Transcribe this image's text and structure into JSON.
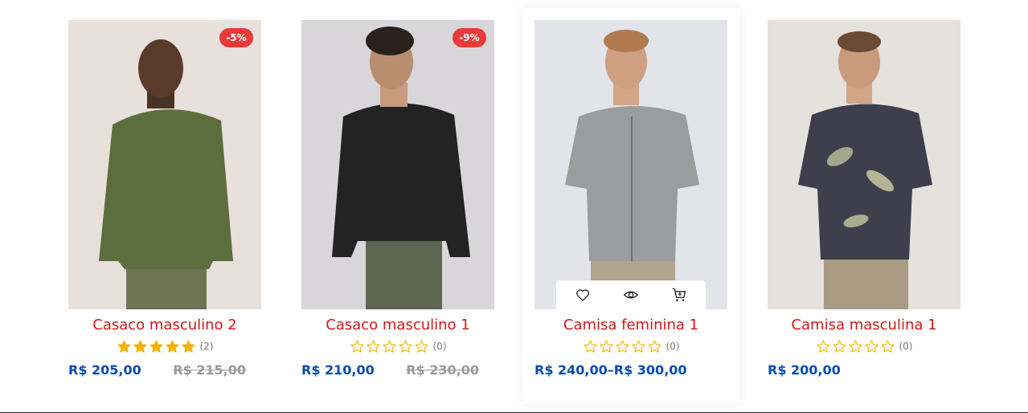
{
  "products": [
    {
      "name": "Casaco masculino 2",
      "badge": "-5%",
      "rating": 5,
      "review_count": "(2)",
      "price": "R$ 205,00",
      "old_price": "R$ 215,00",
      "image": "man-green-sweater"
    },
    {
      "name": "Casaco masculino 1",
      "badge": "-9%",
      "rating": 0,
      "review_count": "(0)",
      "price": "R$ 210,00",
      "old_price": "R$ 230,00",
      "image": "man-black-speckled-sweater"
    },
    {
      "name": "Camisa feminina 1",
      "rating": 0,
      "review_count": "(0)",
      "price": "R$ 240,00–R$ 300,00",
      "image": "man-gray-short-sleeve-shirt",
      "actions": [
        "heart-icon",
        "eye-icon",
        "cart-icon"
      ]
    },
    {
      "name": "Camisa masculina 1",
      "rating": 0,
      "review_count": "(0)",
      "price": "R$ 200,00",
      "image": "man-floral-navy-shirt"
    }
  ],
  "colors": {
    "title": "#d41616",
    "price": "#0a4cad",
    "old_price": "#9a9a9a",
    "badge": "#e83a3a",
    "star": "#f5b301"
  }
}
